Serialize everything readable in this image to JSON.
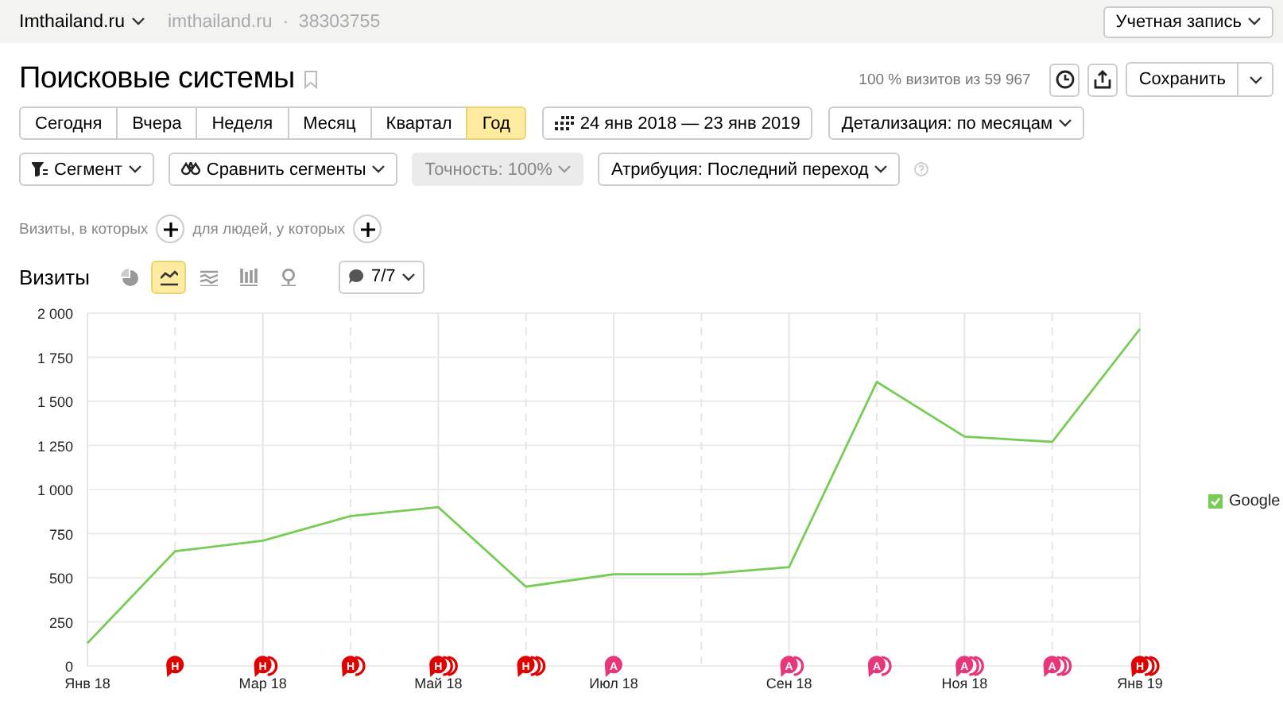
{
  "top_bar": {
    "site": "Imthailand.ru",
    "counter_site": "imthailand.ru",
    "separator": "·",
    "counter_id": "38303755",
    "account_button": "Учетная запись"
  },
  "header": {
    "title": "Поисковые системы",
    "bookmarked": false,
    "share_note": "100 % визитов из 59 967",
    "save_button": "Сохранить"
  },
  "periods": [
    {
      "label": "Сегодня",
      "selected": false
    },
    {
      "label": "Вчера",
      "selected": false
    },
    {
      "label": "Неделя",
      "selected": false
    },
    {
      "label": "Месяц",
      "selected": false
    },
    {
      "label": "Квартал",
      "selected": false
    },
    {
      "label": "Год",
      "selected": true
    }
  ],
  "date_range": "24 янв 2018 — 23 янв 2019",
  "detail": "Детализация: по месяцам",
  "filters": [
    {
      "label": "Сегмент",
      "kind": "segment",
      "disabled": false
    },
    {
      "label": "Сравнить сегменты",
      "kind": "compare",
      "disabled": false
    },
    {
      "label": "Точность: 100%",
      "kind": "plain",
      "disabled": true
    },
    {
      "label": "Атрибуция: Последний переход",
      "kind": "plain",
      "disabled": false
    }
  ],
  "segment_builder": {
    "visits_label": "Визиты, в которых",
    "people_label": "для людей, у которых"
  },
  "chart_section": {
    "title": "Визиты",
    "chart_types": [
      {
        "kind": "pie",
        "selected": false
      },
      {
        "kind": "line",
        "selected": true
      },
      {
        "kind": "area",
        "selected": false
      },
      {
        "kind": "bar",
        "selected": false
      },
      {
        "kind": "map",
        "selected": false
      }
    ],
    "notes_button": "7/7",
    "chart_data": {
      "type": "line",
      "categories": [
        "Янв 18",
        null,
        "Мар 18",
        null,
        "Май 18",
        null,
        "Июл 18",
        null,
        "Сен 18",
        null,
        "Ноя 18",
        null,
        "Янв 19"
      ],
      "yticks": [
        {
          "value": 0,
          "label": "0"
        },
        {
          "value": 250,
          "label": "250"
        },
        {
          "value": 500,
          "label": "500"
        },
        {
          "value": 750,
          "label": "750"
        },
        {
          "value": 1000,
          "label": "1 000"
        },
        {
          "value": 1250,
          "label": "1 250"
        },
        {
          "value": 1500,
          "label": "1 500"
        },
        {
          "value": 1750,
          "label": "1 750"
        },
        {
          "value": 2000,
          "label": "2 000"
        }
      ],
      "ylim": [
        0,
        2000
      ],
      "grid": true,
      "series": [
        {
          "name": "Google",
          "color": "#77cc55",
          "values": [
            130,
            650,
            710,
            850,
            900,
            450,
            520,
            520,
            560,
            1610,
            1300,
            1270,
            1910
          ]
        }
      ]
    },
    "legend": [
      {
        "checked": true
      }
    ],
    "event_markers": [
      {
        "kind": "none"
      },
      {
        "letter": "Н",
        "color": "#e00000",
        "kind": "single"
      },
      {
        "letter": "Н",
        "color": "#e00000",
        "kind": "double"
      },
      {
        "letter": "Н",
        "color": "#e00000",
        "kind": "double"
      },
      {
        "letter": "Н",
        "color": "#e00000",
        "kind": "triple"
      },
      {
        "letter": "Н",
        "color": "#e00000",
        "kind": "triple"
      },
      {
        "letter": "А",
        "color": "#e8367a",
        "kind": "single"
      },
      {
        "kind": "none"
      },
      {
        "letter": "А",
        "color": "#e8367a",
        "kind": "double"
      },
      {
        "letter": "А",
        "color": "#e8367a",
        "kind": "double"
      },
      {
        "letter": "А",
        "color": "#e8367a",
        "kind": "triple"
      },
      {
        "letter": "А",
        "color": "#e8367a",
        "kind": "triple"
      },
      {
        "letter": "Н",
        "color": "#e00000",
        "kind": "triple"
      }
    ]
  }
}
